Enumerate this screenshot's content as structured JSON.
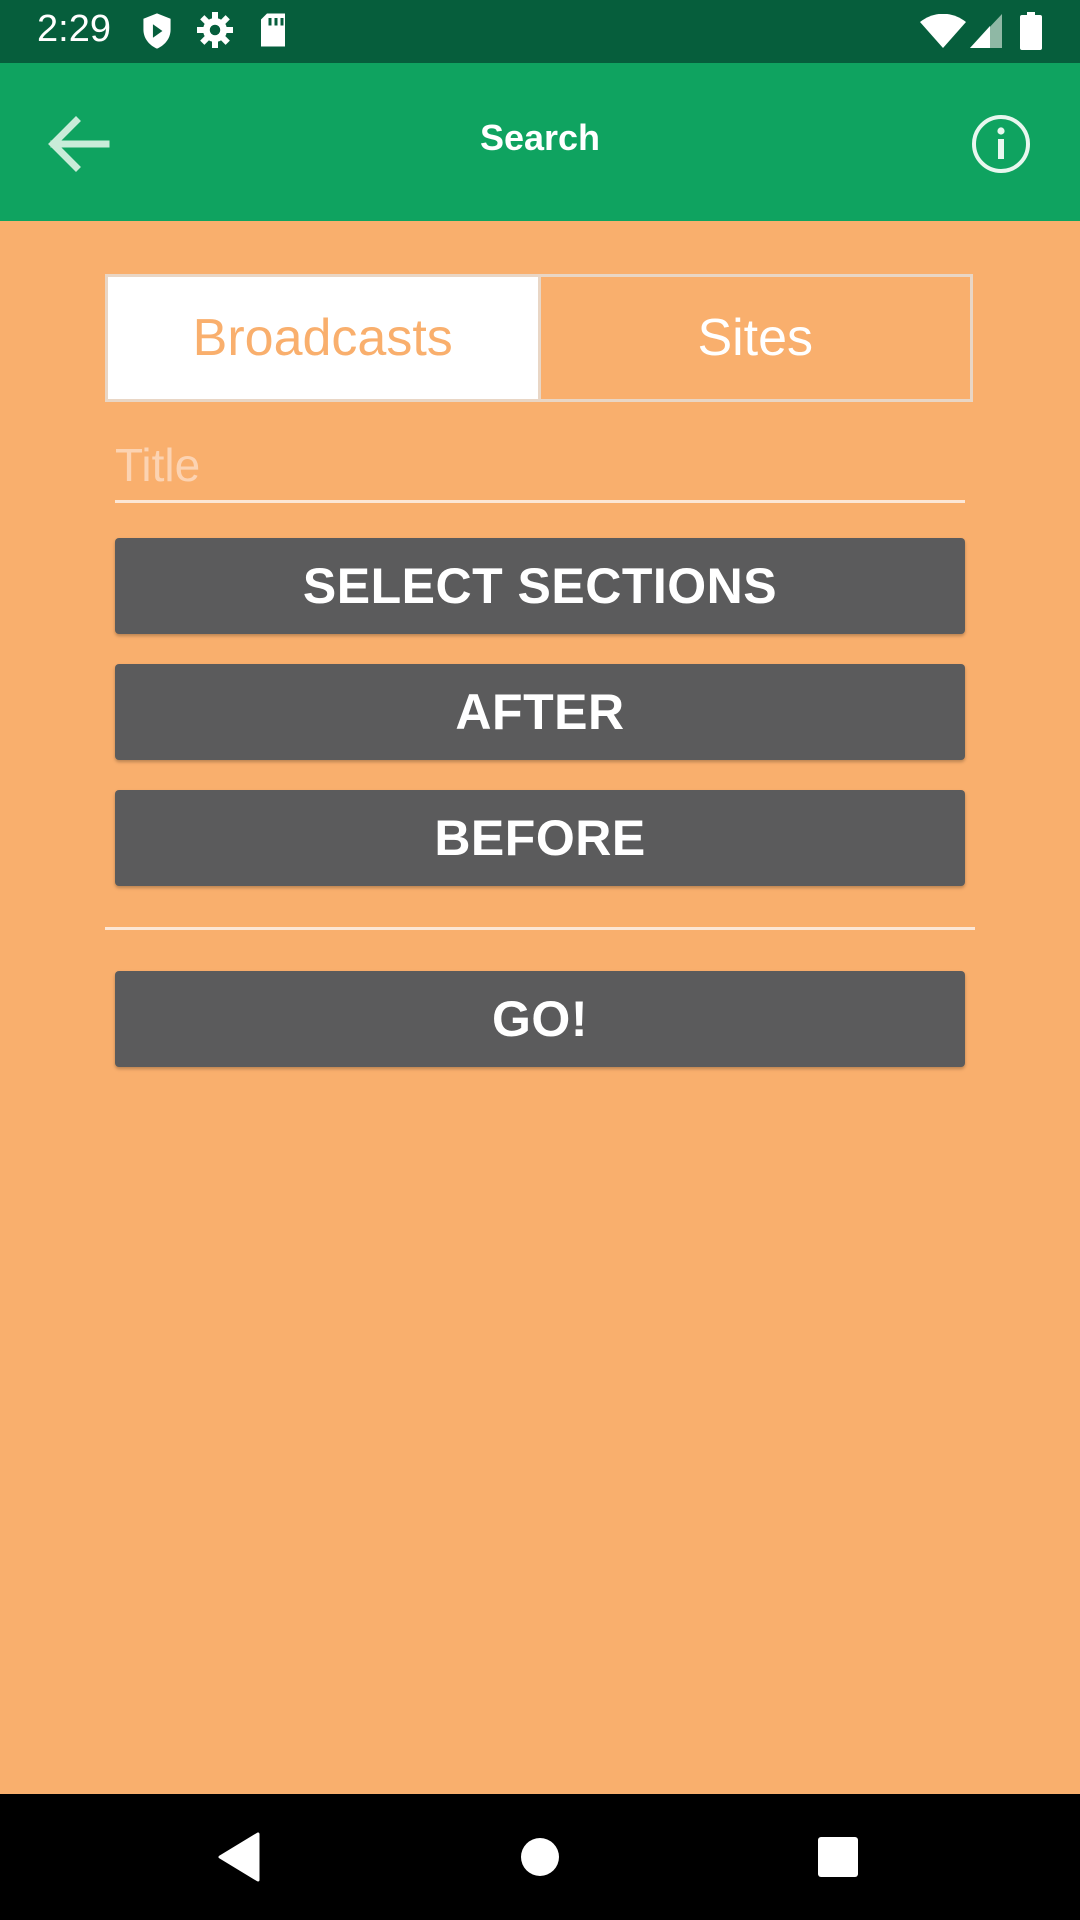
{
  "status_bar": {
    "time": "2:29",
    "icons": [
      "shield-icon",
      "gear-icon",
      "sd-card-icon",
      "wifi-icon",
      "signal-icon",
      "battery-icon"
    ]
  },
  "app_bar": {
    "title": "Search",
    "back_icon": "arrow-left-icon",
    "info_icon": "info-circle-icon"
  },
  "tabs": [
    {
      "label": "Broadcasts",
      "active": true
    },
    {
      "label": "Sites",
      "active": false
    }
  ],
  "search": {
    "title_placeholder": "Title",
    "title_value": ""
  },
  "buttons": {
    "select_sections": "SELECT SECTIONS",
    "after": "AFTER",
    "before": "BEFORE",
    "go": "GO!"
  },
  "colors": {
    "status_bar": "#065E3C",
    "app_bar": "#0FA360",
    "background": "#F9AF6D",
    "button": "#5B5B5C"
  },
  "nav_bar": {
    "icons": [
      "back-triangle-icon",
      "home-circle-icon",
      "recents-square-icon"
    ]
  }
}
